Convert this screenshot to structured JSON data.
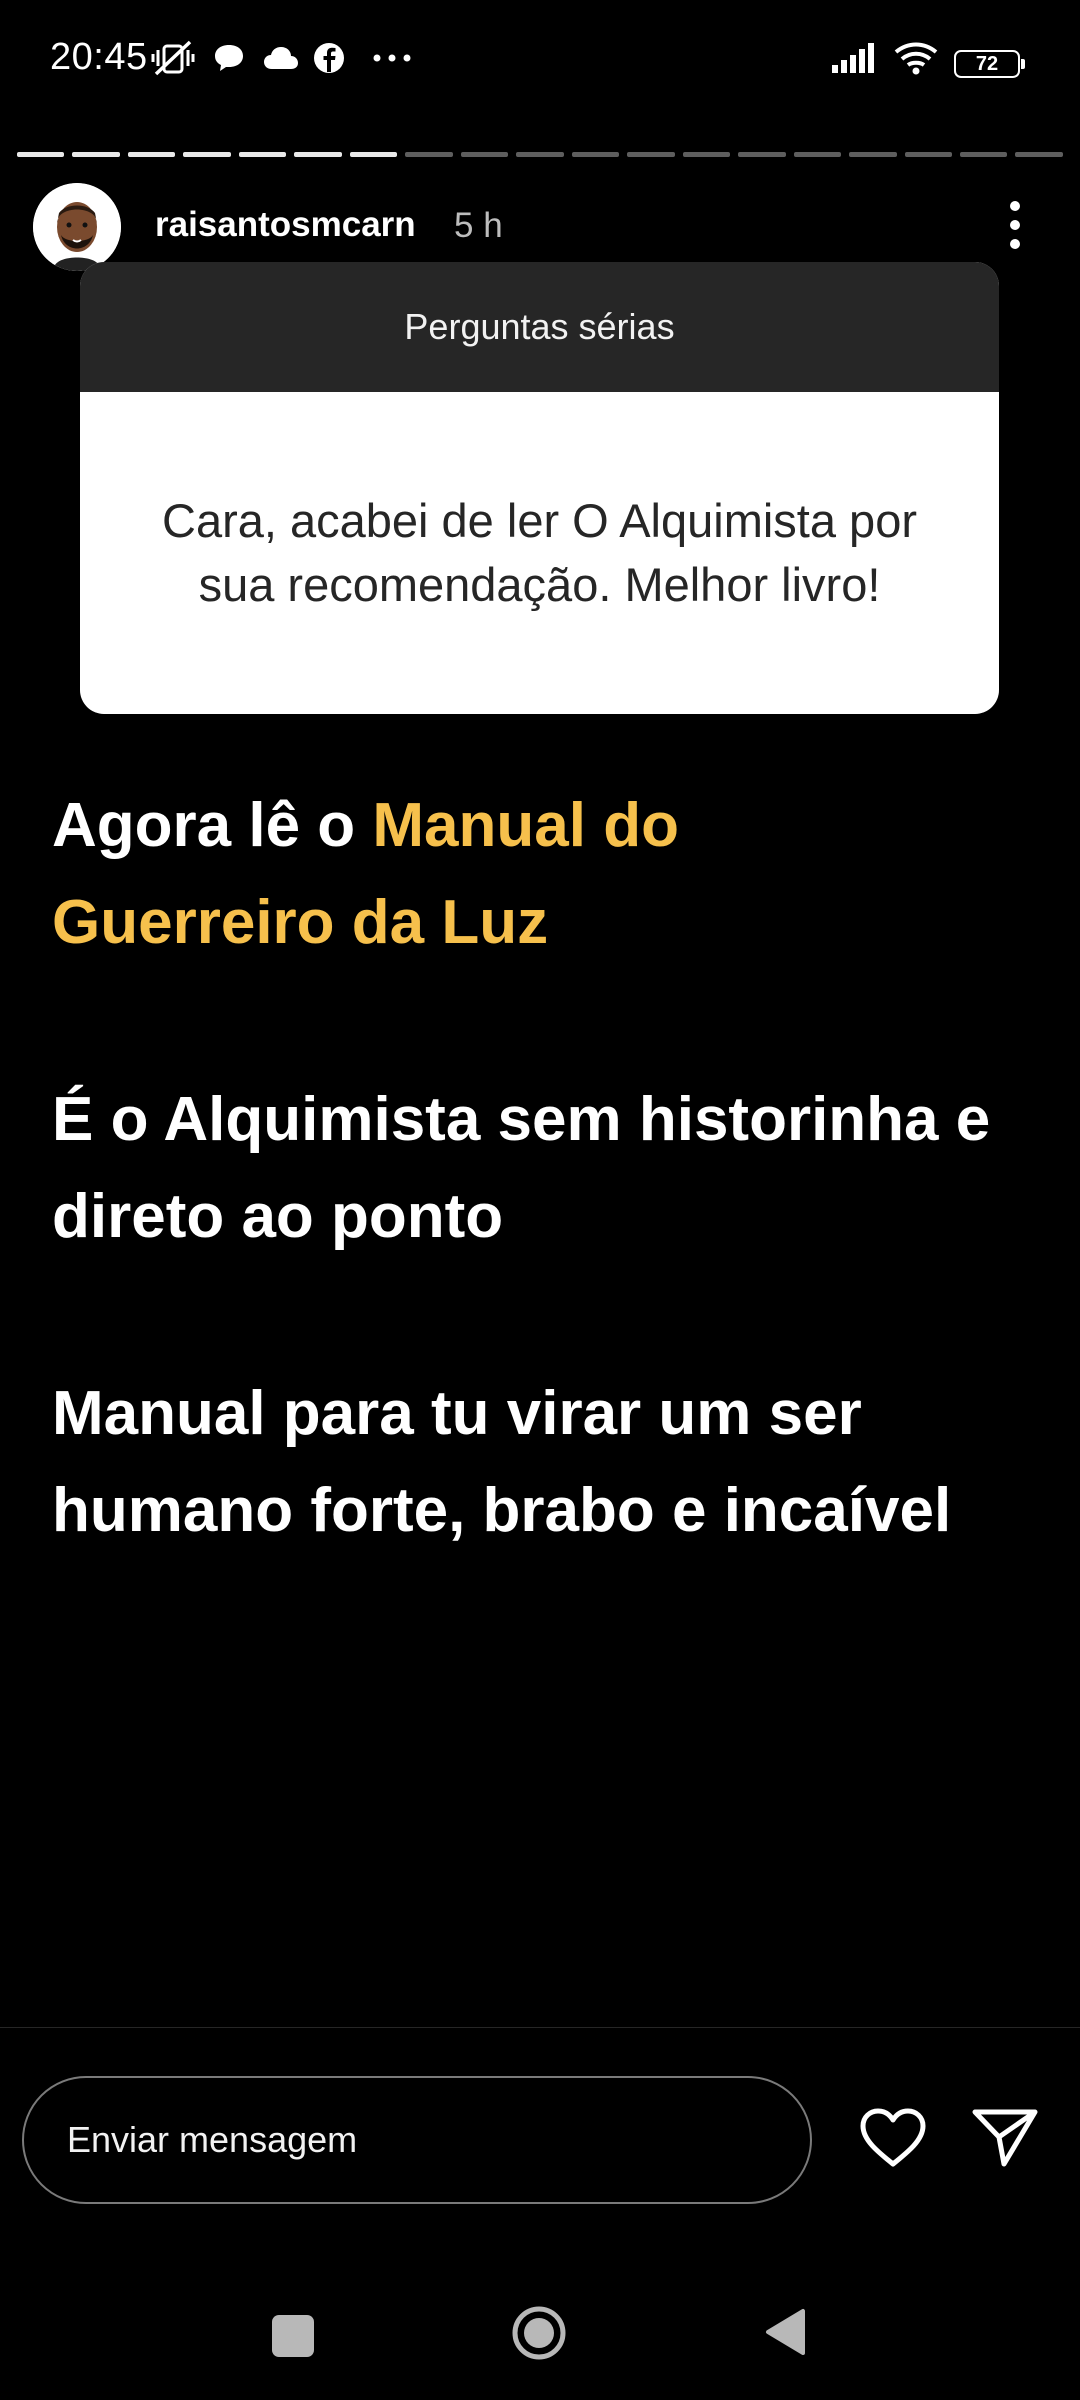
{
  "status_bar": {
    "time": "20:45",
    "battery": "72",
    "icons": [
      "mute-vibrate-icon",
      "chat-bubble-icon",
      "cloud-icon",
      "facebook-icon",
      "more-dots-icon",
      "signal-icon",
      "wifi-icon",
      "battery-icon"
    ]
  },
  "story": {
    "segments_total": 19,
    "segments_viewed": 7,
    "username": "raisantosmcarn",
    "time_ago": "5 h",
    "question_card": {
      "title": "Perguntas sérias",
      "question": "Cara, acabei de ler O Alquimista por sua recomendação. Melhor livro!"
    },
    "paragraph1_prefix": "Agora lê o ",
    "paragraph1_highlight": "Manual do Guerreiro da Luz",
    "paragraph2": "É o Alquimista sem historinha e direto ao ponto",
    "paragraph3": "Manual para tu virar um ser humano forte, brabo e incaível",
    "highlight_color": "#f6c04c"
  },
  "reply": {
    "placeholder": "Enviar mensagem"
  },
  "nav": {
    "icons": [
      "recents-icon",
      "home-icon",
      "back-icon"
    ]
  }
}
